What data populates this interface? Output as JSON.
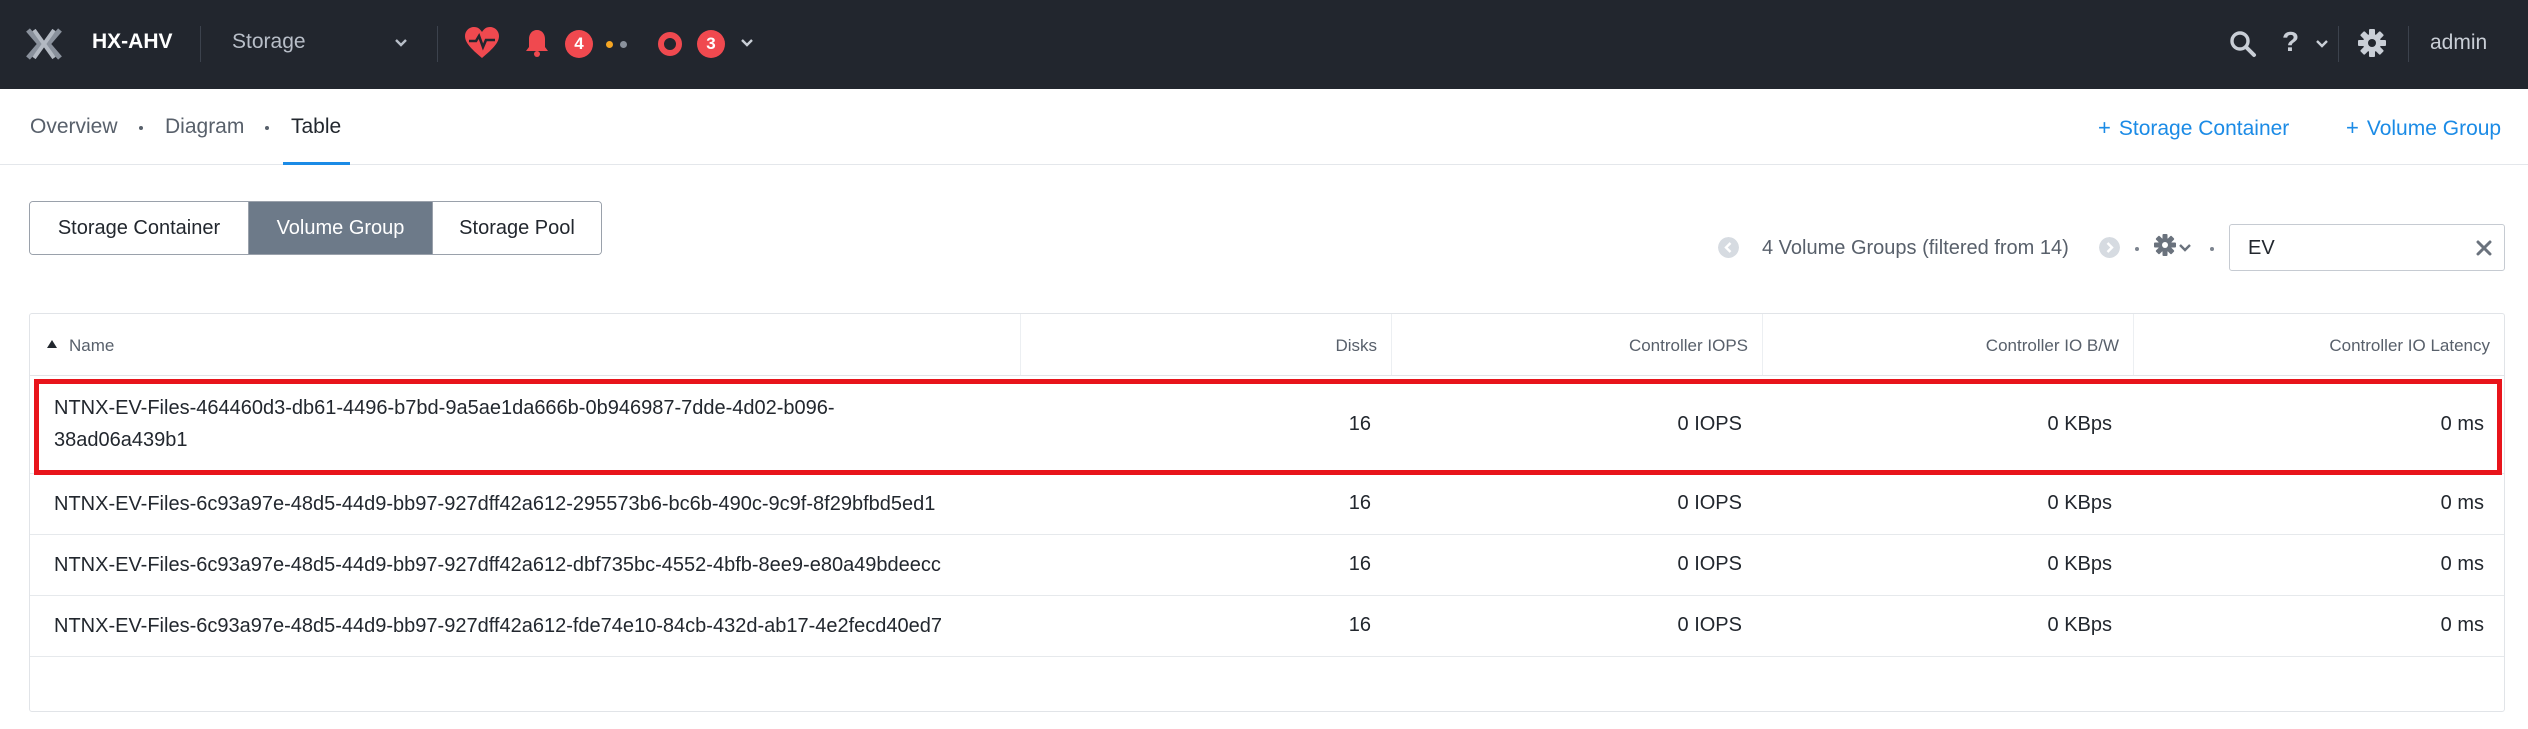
{
  "header": {
    "cluster_name": "HX-AHV",
    "entity_selector": "Storage",
    "alert_count": "4",
    "event_count": "3",
    "user": "admin",
    "help_label": "?"
  },
  "subnav": {
    "tabs": [
      {
        "label": "Overview"
      },
      {
        "label": "Diagram"
      },
      {
        "label": "Table"
      }
    ],
    "actions": {
      "storage_container": "Storage Container",
      "volume_group": "Volume Group",
      "plus": "+"
    }
  },
  "segmented": {
    "items": [
      {
        "label": "Storage Container"
      },
      {
        "label": "Volume Group"
      },
      {
        "label": "Storage Pool"
      }
    ],
    "selected": "Volume Group"
  },
  "pagination": {
    "info": "4 Volume Groups (filtered from 14)"
  },
  "search": {
    "value": "EV"
  },
  "table": {
    "columns": {
      "name": "Name",
      "disks": "Disks",
      "iops": "Controller IOPS",
      "bw": "Controller IO B/W",
      "latency": "Controller IO Latency"
    },
    "rows": [
      {
        "name_line1": "NTNX-EV-Files-464460d3-db61-4496-b7bd-9a5ae1da666b-0b946987-7dde-4d02-b096-",
        "name_line2": "38ad06a439b1",
        "disks": "16",
        "iops": "0 IOPS",
        "bw": "0 KBps",
        "latency": "0 ms"
      },
      {
        "name_line1": "NTNX-EV-Files-6c93a97e-48d5-44d9-bb97-927dff42a612-295573b6-bc6b-490c-9c9f-8f29bfbd5ed1",
        "name_line2": "",
        "disks": "16",
        "iops": "0 IOPS",
        "bw": "0 KBps",
        "latency": "0 ms"
      },
      {
        "name_line1": "NTNX-EV-Files-6c93a97e-48d5-44d9-bb97-927dff42a612-dbf735bc-4552-4bfb-8ee9-e80a49bdeecc",
        "name_line2": "",
        "disks": "16",
        "iops": "0 IOPS",
        "bw": "0 KBps",
        "latency": "0 ms"
      },
      {
        "name_line1": "NTNX-EV-Files-6c93a97e-48d5-44d9-bb97-927dff42a612-fde74e10-84cb-432d-ab17-4e2fecd40ed7",
        "name_line2": "",
        "disks": "16",
        "iops": "0 IOPS",
        "bw": "0 KBps",
        "latency": "0 ms"
      }
    ]
  },
  "colors": {
    "header_bg": "#22262e",
    "accent": "#1b8be6",
    "alert": "#f0494f",
    "highlight": "#e8141b",
    "segment_active": "#6d7a89"
  },
  "icons": [
    "nutanix-logo-icon",
    "chevron-down-icon",
    "health-heart-icon",
    "bell-icon",
    "event-ring-icon",
    "search-icon",
    "help-icon",
    "gear-icon",
    "sort-asc-icon",
    "clear-icon",
    "page-prev-icon",
    "page-next-icon"
  ]
}
